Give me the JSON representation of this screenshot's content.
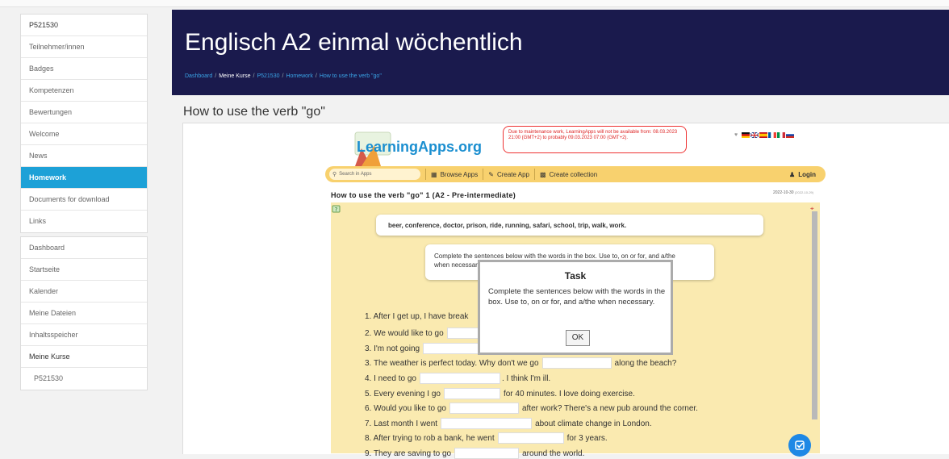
{
  "sidebar": {
    "group1": [
      "P521530",
      "Teilnehmer/innen",
      "Badges",
      "Kompetenzen",
      "Bewertungen",
      "Welcome",
      "News",
      "Homework",
      "Documents for download",
      "Links"
    ],
    "active": "Homework",
    "group2": [
      "Dashboard",
      "Startseite",
      "Kalender",
      "Meine Dateien",
      "Inhaltsspeicher",
      "Meine Kurse",
      "P521530"
    ]
  },
  "header": {
    "title": "Englisch A2 einmal wöchentlich",
    "breadcrumb": [
      "Dashboard",
      "Meine Kurse",
      "P521530",
      "Homework",
      "How to use the verb \"go\""
    ],
    "separator": "/"
  },
  "page_title": "How to use the verb \"go\"",
  "learningapps": {
    "logo": "LearningApps.org",
    "notice": "Due to maintenance work, LearningApps will not be available from: 08.03.2023 21:00 (GMT+2) to probably 09.03.2023 07:00 (GMT+2).",
    "nav": {
      "search_placeholder": "Search in Apps",
      "browse": "Browse Apps",
      "create": "Create App",
      "collection": "Create collection",
      "login": "Login"
    },
    "app_title": "How to use the verb \"go\" 1 (A2 - Pre-intermediate)",
    "app_date": "2022-10-30",
    "app_date_small": "(2022-10-29)",
    "words": "beer, conference, doctor, prison, ride, running, safari, school, trip, walk, work.",
    "instruction_a": "Complete the sentences below with the words in the box. Use to, on or for, and a/the",
    "instruction_b": "when necessary.",
    "sentences": [
      {
        "a": "1. After I get up, I have break",
        "b": ""
      },
      {
        "a": "2. We would like to go",
        "b": ""
      },
      {
        "a": "3. I'm not going",
        "b": ""
      },
      {
        "a": "3. The weather is perfect today. Why don't we go",
        "b": "along the beach?"
      },
      {
        "a": "4. I need to go",
        "b": ". I think I'm ill."
      },
      {
        "a": "5. Every evening I go",
        "b": "for 40 minutes. I love doing exercise."
      },
      {
        "a": "6. Would you like to go",
        "b": "after work? There's a new pub around the corner."
      },
      {
        "a": "7. Last month I went",
        "b": "about climate change in London."
      },
      {
        "a": "8. After trying to rob a bank, he went",
        "b": "for 3 years."
      },
      {
        "a": "9. They are saving to go",
        "b": "around the world."
      }
    ],
    "dialog": {
      "title": "Task",
      "body": "Complete the sentences below with the words in the box. Use to, on or for, and a/the when necessary.",
      "ok": "OK"
    }
  },
  "colors": {
    "header_bg": "#1a1a4d",
    "active_item": "#1da1d7",
    "nav_bar": "#f8d16e",
    "app_bg": "#faeab0",
    "notice": "#dd2222"
  }
}
